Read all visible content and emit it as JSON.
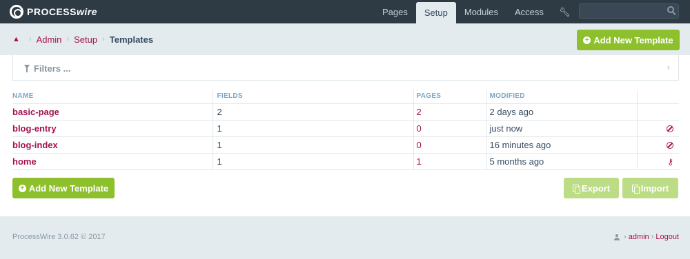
{
  "brand": {
    "name_plain": "PROCESS",
    "name_italic": "wire"
  },
  "nav": {
    "items": [
      {
        "label": "Pages",
        "active": false
      },
      {
        "label": "Setup",
        "active": true
      },
      {
        "label": "Modules",
        "active": false
      },
      {
        "label": "Access",
        "active": false
      }
    ],
    "tools_icon": "wrench-icon",
    "search_placeholder": ""
  },
  "breadcrumb": {
    "home_icon": "sitemap-icon",
    "items": [
      "Admin",
      "Setup"
    ],
    "current": "Templates"
  },
  "actions": {
    "add_new_template": "Add New Template",
    "export": "Export",
    "import": "Import"
  },
  "filters": {
    "label": "Filters ..."
  },
  "table": {
    "headers": [
      "NAME",
      "FIELDS",
      "PAGES",
      "MODIFIED"
    ],
    "rows": [
      {
        "name": "basic-page",
        "fields": "2",
        "pages": "2",
        "modified": "2 days ago",
        "icon": ""
      },
      {
        "name": "blog-entry",
        "fields": "1",
        "pages": "0",
        "modified": "just now",
        "icon": "ban-icon"
      },
      {
        "name": "blog-index",
        "fields": "1",
        "pages": "0",
        "modified": "16 minutes ago",
        "icon": "ban-icon"
      },
      {
        "name": "home",
        "fields": "1",
        "pages": "1",
        "modified": "5 months ago",
        "icon": "key-icon"
      }
    ]
  },
  "footer": {
    "version": "ProcessWire 3.0.62 © 2017",
    "user": "admin",
    "logout": "Logout"
  },
  "colors": {
    "masthead": "#2e3a44",
    "accent": "#a4124f",
    "button": "#8dc02c",
    "button_disabled": "#bcdc85",
    "background": "#e4ebee"
  }
}
